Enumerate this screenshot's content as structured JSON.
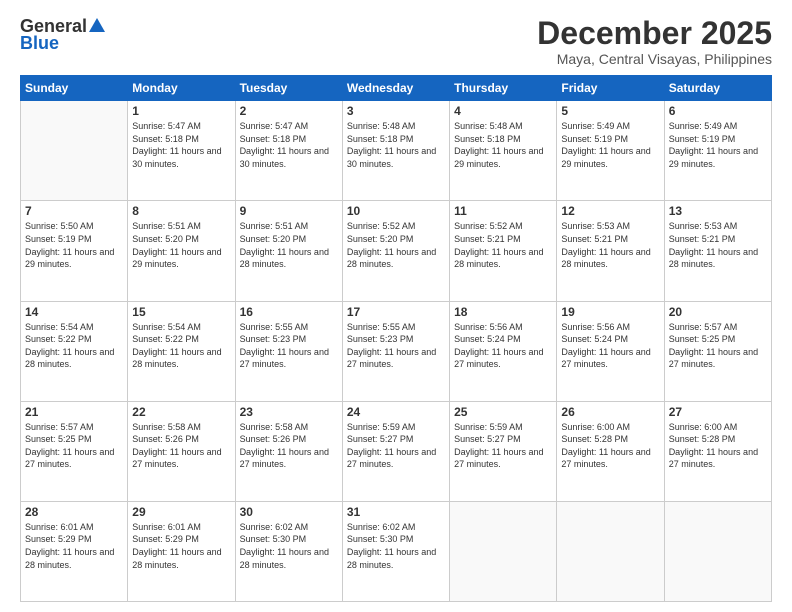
{
  "header": {
    "logo_general": "General",
    "logo_blue": "Blue",
    "month_title": "December 2025",
    "location": "Maya, Central Visayas, Philippines"
  },
  "days_of_week": [
    "Sunday",
    "Monday",
    "Tuesday",
    "Wednesday",
    "Thursday",
    "Friday",
    "Saturday"
  ],
  "weeks": [
    [
      {
        "day": "",
        "sunrise": "",
        "sunset": "",
        "daylight": "",
        "empty": true
      },
      {
        "day": "1",
        "sunrise": "Sunrise: 5:47 AM",
        "sunset": "Sunset: 5:18 PM",
        "daylight": "Daylight: 11 hours and 30 minutes."
      },
      {
        "day": "2",
        "sunrise": "Sunrise: 5:47 AM",
        "sunset": "Sunset: 5:18 PM",
        "daylight": "Daylight: 11 hours and 30 minutes."
      },
      {
        "day": "3",
        "sunrise": "Sunrise: 5:48 AM",
        "sunset": "Sunset: 5:18 PM",
        "daylight": "Daylight: 11 hours and 30 minutes."
      },
      {
        "day": "4",
        "sunrise": "Sunrise: 5:48 AM",
        "sunset": "Sunset: 5:18 PM",
        "daylight": "Daylight: 11 hours and 29 minutes."
      },
      {
        "day": "5",
        "sunrise": "Sunrise: 5:49 AM",
        "sunset": "Sunset: 5:19 PM",
        "daylight": "Daylight: 11 hours and 29 minutes."
      },
      {
        "day": "6",
        "sunrise": "Sunrise: 5:49 AM",
        "sunset": "Sunset: 5:19 PM",
        "daylight": "Daylight: 11 hours and 29 minutes."
      }
    ],
    [
      {
        "day": "7",
        "sunrise": "Sunrise: 5:50 AM",
        "sunset": "Sunset: 5:19 PM",
        "daylight": "Daylight: 11 hours and 29 minutes."
      },
      {
        "day": "8",
        "sunrise": "Sunrise: 5:51 AM",
        "sunset": "Sunset: 5:20 PM",
        "daylight": "Daylight: 11 hours and 29 minutes."
      },
      {
        "day": "9",
        "sunrise": "Sunrise: 5:51 AM",
        "sunset": "Sunset: 5:20 PM",
        "daylight": "Daylight: 11 hours and 28 minutes."
      },
      {
        "day": "10",
        "sunrise": "Sunrise: 5:52 AM",
        "sunset": "Sunset: 5:20 PM",
        "daylight": "Daylight: 11 hours and 28 minutes."
      },
      {
        "day": "11",
        "sunrise": "Sunrise: 5:52 AM",
        "sunset": "Sunset: 5:21 PM",
        "daylight": "Daylight: 11 hours and 28 minutes."
      },
      {
        "day": "12",
        "sunrise": "Sunrise: 5:53 AM",
        "sunset": "Sunset: 5:21 PM",
        "daylight": "Daylight: 11 hours and 28 minutes."
      },
      {
        "day": "13",
        "sunrise": "Sunrise: 5:53 AM",
        "sunset": "Sunset: 5:21 PM",
        "daylight": "Daylight: 11 hours and 28 minutes."
      }
    ],
    [
      {
        "day": "14",
        "sunrise": "Sunrise: 5:54 AM",
        "sunset": "Sunset: 5:22 PM",
        "daylight": "Daylight: 11 hours and 28 minutes."
      },
      {
        "day": "15",
        "sunrise": "Sunrise: 5:54 AM",
        "sunset": "Sunset: 5:22 PM",
        "daylight": "Daylight: 11 hours and 28 minutes."
      },
      {
        "day": "16",
        "sunrise": "Sunrise: 5:55 AM",
        "sunset": "Sunset: 5:23 PM",
        "daylight": "Daylight: 11 hours and 27 minutes."
      },
      {
        "day": "17",
        "sunrise": "Sunrise: 5:55 AM",
        "sunset": "Sunset: 5:23 PM",
        "daylight": "Daylight: 11 hours and 27 minutes."
      },
      {
        "day": "18",
        "sunrise": "Sunrise: 5:56 AM",
        "sunset": "Sunset: 5:24 PM",
        "daylight": "Daylight: 11 hours and 27 minutes."
      },
      {
        "day": "19",
        "sunrise": "Sunrise: 5:56 AM",
        "sunset": "Sunset: 5:24 PM",
        "daylight": "Daylight: 11 hours and 27 minutes."
      },
      {
        "day": "20",
        "sunrise": "Sunrise: 5:57 AM",
        "sunset": "Sunset: 5:25 PM",
        "daylight": "Daylight: 11 hours and 27 minutes."
      }
    ],
    [
      {
        "day": "21",
        "sunrise": "Sunrise: 5:57 AM",
        "sunset": "Sunset: 5:25 PM",
        "daylight": "Daylight: 11 hours and 27 minutes."
      },
      {
        "day": "22",
        "sunrise": "Sunrise: 5:58 AM",
        "sunset": "Sunset: 5:26 PM",
        "daylight": "Daylight: 11 hours and 27 minutes."
      },
      {
        "day": "23",
        "sunrise": "Sunrise: 5:58 AM",
        "sunset": "Sunset: 5:26 PM",
        "daylight": "Daylight: 11 hours and 27 minutes."
      },
      {
        "day": "24",
        "sunrise": "Sunrise: 5:59 AM",
        "sunset": "Sunset: 5:27 PM",
        "daylight": "Daylight: 11 hours and 27 minutes."
      },
      {
        "day": "25",
        "sunrise": "Sunrise: 5:59 AM",
        "sunset": "Sunset: 5:27 PM",
        "daylight": "Daylight: 11 hours and 27 minutes."
      },
      {
        "day": "26",
        "sunrise": "Sunrise: 6:00 AM",
        "sunset": "Sunset: 5:28 PM",
        "daylight": "Daylight: 11 hours and 27 minutes."
      },
      {
        "day": "27",
        "sunrise": "Sunrise: 6:00 AM",
        "sunset": "Sunset: 5:28 PM",
        "daylight": "Daylight: 11 hours and 27 minutes."
      }
    ],
    [
      {
        "day": "28",
        "sunrise": "Sunrise: 6:01 AM",
        "sunset": "Sunset: 5:29 PM",
        "daylight": "Daylight: 11 hours and 28 minutes."
      },
      {
        "day": "29",
        "sunrise": "Sunrise: 6:01 AM",
        "sunset": "Sunset: 5:29 PM",
        "daylight": "Daylight: 11 hours and 28 minutes."
      },
      {
        "day": "30",
        "sunrise": "Sunrise: 6:02 AM",
        "sunset": "Sunset: 5:30 PM",
        "daylight": "Daylight: 11 hours and 28 minutes."
      },
      {
        "day": "31",
        "sunrise": "Sunrise: 6:02 AM",
        "sunset": "Sunset: 5:30 PM",
        "daylight": "Daylight: 11 hours and 28 minutes."
      },
      {
        "day": "",
        "sunrise": "",
        "sunset": "",
        "daylight": "",
        "empty": true
      },
      {
        "day": "",
        "sunrise": "",
        "sunset": "",
        "daylight": "",
        "empty": true
      },
      {
        "day": "",
        "sunrise": "",
        "sunset": "",
        "daylight": "",
        "empty": true
      }
    ]
  ]
}
